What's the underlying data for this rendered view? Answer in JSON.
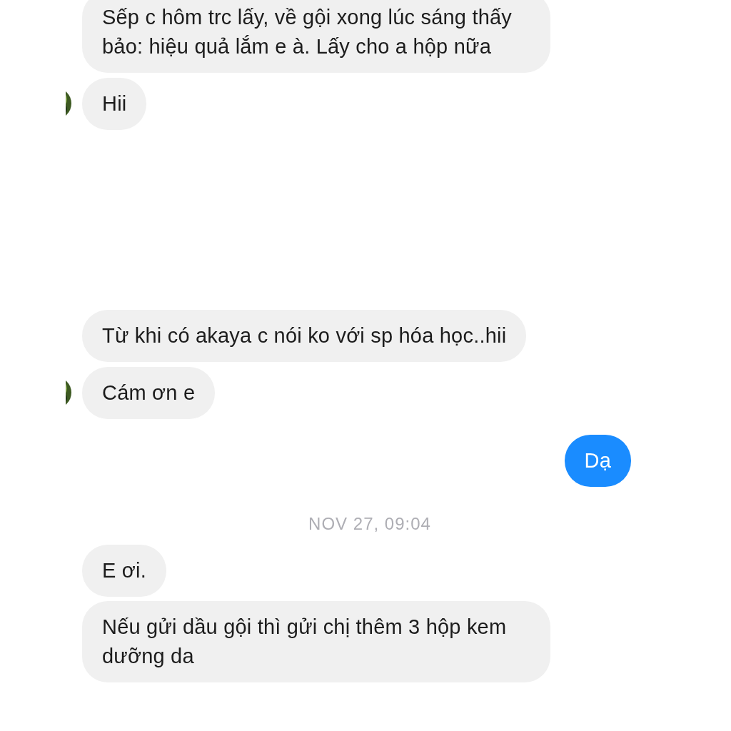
{
  "messages": [
    {
      "kind": "incoming",
      "text": "Sếp c hôm trc lấy, về gội xong lúc sáng thấy bảo: hiệu quả lắm e à. Lấy cho a hộp nữa",
      "avatar": false
    },
    {
      "kind": "incoming",
      "text": "Hii",
      "avatar": true
    },
    {
      "kind": "gap"
    },
    {
      "kind": "incoming",
      "text": "Từ khi có akaya c nói ko với sp hóa học..hii",
      "avatar": false
    },
    {
      "kind": "incoming",
      "text": "Cám ơn e",
      "avatar": true
    },
    {
      "kind": "outgoing",
      "text": "Dạ"
    },
    {
      "kind": "timestamp",
      "text": "NOV 27, 09:04"
    },
    {
      "kind": "incoming",
      "text": "E ơi.",
      "avatar": false
    },
    {
      "kind": "incoming",
      "text": "Nếu gửi dầu gội thì gửi chị thêm 3 hộp kem dưỡng da",
      "avatar": false
    }
  ]
}
